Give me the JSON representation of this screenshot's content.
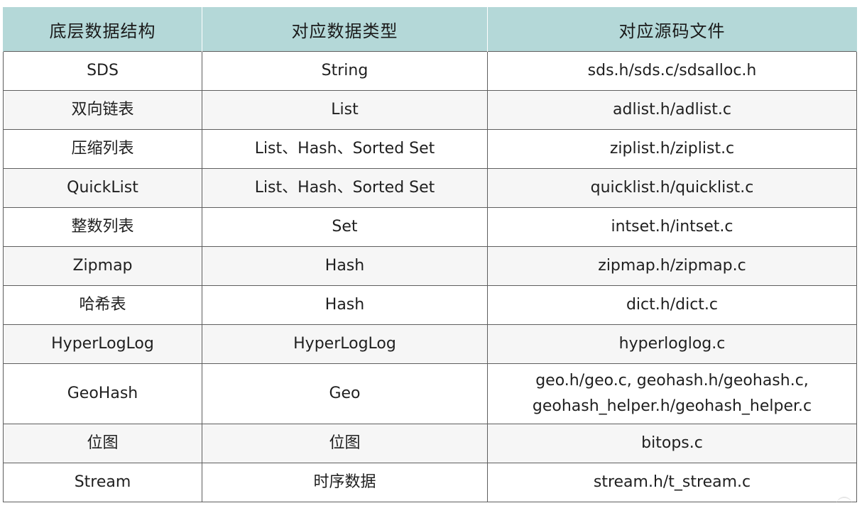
{
  "table": {
    "headers": [
      "底层数据结构",
      "对应数据类型",
      "对应源码文件"
    ],
    "rows": [
      {
        "structure": "SDS",
        "type": "String",
        "files": [
          "sds.h/sds.c/sdsalloc.h"
        ]
      },
      {
        "structure": "双向链表",
        "type": "List",
        "files": [
          "adlist.h/adlist.c"
        ]
      },
      {
        "structure": "压缩列表",
        "type": "List、Hash、Sorted Set",
        "files": [
          "ziplist.h/ziplist.c"
        ]
      },
      {
        "structure": "QuickList",
        "type": "List、Hash、Sorted Set",
        "files": [
          "quicklist.h/quicklist.c"
        ]
      },
      {
        "structure": "整数列表",
        "type": "Set",
        "files": [
          "intset.h/intset.c"
        ]
      },
      {
        "structure": "Zipmap",
        "type": "Hash",
        "files": [
          "zipmap.h/zipmap.c"
        ]
      },
      {
        "structure": "哈希表",
        "type": "Hash",
        "files": [
          "dict.h/dict.c"
        ]
      },
      {
        "structure": "HyperLogLog",
        "type": "HyperLogLog",
        "files": [
          "hyperloglog.c"
        ]
      },
      {
        "structure": "GeoHash",
        "type": "Geo",
        "files": [
          "geo.h/geo.c, geohash.h/geohash.c,",
          "geohash_helper.h/geohash_helper.c"
        ]
      },
      {
        "structure": "位图",
        "type": "位图",
        "files": [
          "bitops.c"
        ]
      },
      {
        "structure": "Stream",
        "type": "时序数据",
        "files": [
          "stream.h/t_stream.c"
        ]
      }
    ]
  },
  "colors": {
    "header_bg": "#b4d8d8",
    "border": "#5e5e5e",
    "alt_row_bg": "#f6f6f6"
  }
}
